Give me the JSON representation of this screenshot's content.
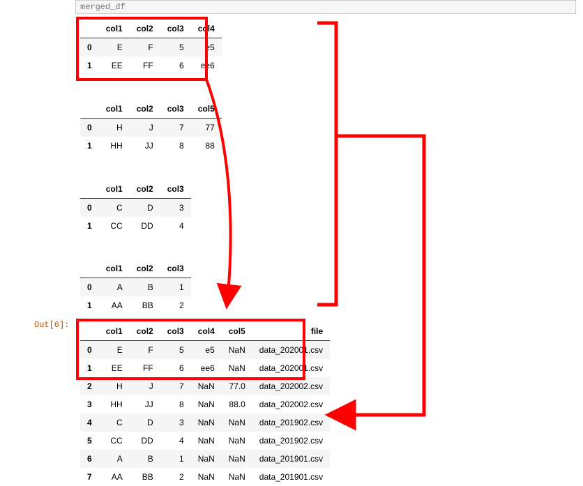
{
  "input_bar": "merged_df",
  "out_label": "Out[6]:",
  "tables": {
    "t1": {
      "headers": [
        "col1",
        "col2",
        "col3",
        "col4"
      ],
      "rows": [
        {
          "idx": "0",
          "cells": [
            "E",
            "F",
            "5",
            "e5"
          ]
        },
        {
          "idx": "1",
          "cells": [
            "EE",
            "FF",
            "6",
            "ee6"
          ]
        }
      ]
    },
    "t2": {
      "headers": [
        "col1",
        "col2",
        "col3",
        "col5"
      ],
      "rows": [
        {
          "idx": "0",
          "cells": [
            "H",
            "J",
            "7",
            "77"
          ]
        },
        {
          "idx": "1",
          "cells": [
            "HH",
            "JJ",
            "8",
            "88"
          ]
        }
      ]
    },
    "t3": {
      "headers": [
        "col1",
        "col2",
        "col3"
      ],
      "rows": [
        {
          "idx": "0",
          "cells": [
            "C",
            "D",
            "3"
          ]
        },
        {
          "idx": "1",
          "cells": [
            "CC",
            "DD",
            "4"
          ]
        }
      ]
    },
    "t4": {
      "headers": [
        "col1",
        "col2",
        "col3"
      ],
      "rows": [
        {
          "idx": "0",
          "cells": [
            "A",
            "B",
            "1"
          ]
        },
        {
          "idx": "1",
          "cells": [
            "AA",
            "BB",
            "2"
          ]
        }
      ]
    },
    "tout": {
      "headers": [
        "col1",
        "col2",
        "col3",
        "col4",
        "col5",
        "file"
      ],
      "rows": [
        {
          "idx": "0",
          "cells": [
            "E",
            "F",
            "5",
            "e5",
            "NaN",
            "data_202001.csv"
          ]
        },
        {
          "idx": "1",
          "cells": [
            "EE",
            "FF",
            "6",
            "ee6",
            "NaN",
            "data_202001.csv"
          ]
        },
        {
          "idx": "2",
          "cells": [
            "H",
            "J",
            "7",
            "NaN",
            "77.0",
            "data_202002.csv"
          ]
        },
        {
          "idx": "3",
          "cells": [
            "HH",
            "JJ",
            "8",
            "NaN",
            "88.0",
            "data_202002.csv"
          ]
        },
        {
          "idx": "4",
          "cells": [
            "C",
            "D",
            "3",
            "NaN",
            "NaN",
            "data_201902.csv"
          ]
        },
        {
          "idx": "5",
          "cells": [
            "CC",
            "DD",
            "4",
            "NaN",
            "NaN",
            "data_201902.csv"
          ]
        },
        {
          "idx": "6",
          "cells": [
            "A",
            "B",
            "1",
            "NaN",
            "NaN",
            "data_201901.csv"
          ]
        },
        {
          "idx": "7",
          "cells": [
            "AA",
            "BB",
            "2",
            "NaN",
            "NaN",
            "data_201901.csv"
          ]
        }
      ]
    }
  }
}
